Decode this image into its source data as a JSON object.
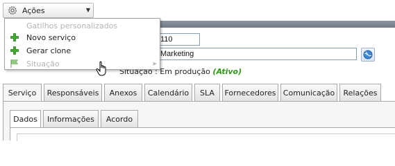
{
  "actions_button": {
    "label": "Ações",
    "icon": "gear-icon"
  },
  "menu": {
    "items": [
      {
        "label": "Gatilhos personalizados",
        "enabled": false,
        "icon": ""
      },
      {
        "label": "Novo serviço",
        "enabled": true,
        "icon": "plus-icon"
      },
      {
        "label": "Gerar clone",
        "enabled": true,
        "icon": "plus-icon"
      },
      {
        "label": "Situação",
        "enabled": false,
        "icon": "flag-icon",
        "has_submenu": true
      }
    ]
  },
  "form": {
    "id_value": "110",
    "name_value": "Marketing",
    "status_label": "Situação : Em produção",
    "status_value": "(Ativo)"
  },
  "tabs": [
    {
      "label": "Serviço",
      "active": true
    },
    {
      "label": "Responsáveis",
      "active": false
    },
    {
      "label": "Anexos",
      "active": false
    },
    {
      "label": "Calendário",
      "active": false
    },
    {
      "label": "SLA",
      "active": false
    },
    {
      "label": "Fornecedores",
      "active": false
    },
    {
      "label": "Comunicação",
      "active": false
    },
    {
      "label": "Relações",
      "active": false
    }
  ],
  "subtabs": [
    {
      "label": "Dados",
      "active": true
    },
    {
      "label": "Informações",
      "active": false
    },
    {
      "label": "Acordo",
      "active": false
    }
  ],
  "colors": {
    "status_active": "#2e9a18",
    "field_border": "#7f9db9"
  }
}
